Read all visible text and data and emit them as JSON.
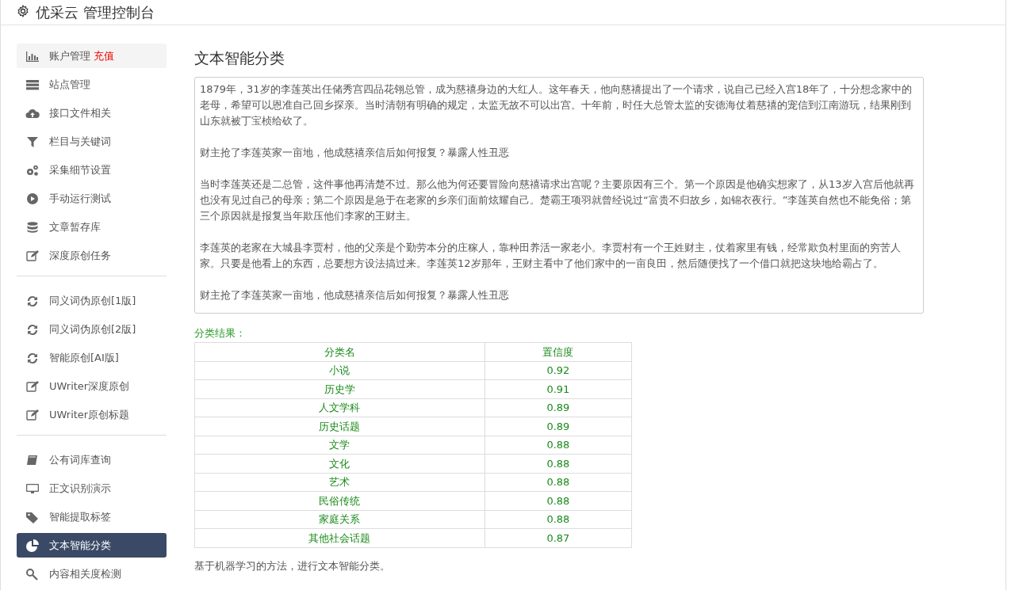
{
  "header": {
    "title": "优采云 管理控制台"
  },
  "sidebar": {
    "groups": [
      [
        {
          "label": "账户管理",
          "badge": "充值",
          "selected": false
        },
        {
          "label": "站点管理",
          "selected": false
        },
        {
          "label": "接口文件相关",
          "selected": false
        },
        {
          "label": "栏目与关键词",
          "selected": false
        },
        {
          "label": "采集细节设置",
          "selected": false
        },
        {
          "label": "手动运行测试",
          "selected": false
        },
        {
          "label": "文章暂存库",
          "selected": false
        },
        {
          "label": "深度原创任务",
          "selected": false
        }
      ],
      [
        {
          "label": "同义词伪原创[1版]",
          "selected": false
        },
        {
          "label": "同义词伪原创[2版]",
          "selected": false
        },
        {
          "label": "智能原创[AI版]",
          "selected": false
        },
        {
          "label": "UWriter深度原创",
          "selected": false
        },
        {
          "label": "UWriter原创标题",
          "selected": false
        }
      ],
      [
        {
          "label": "公有词库查询",
          "selected": false
        },
        {
          "label": "正文识别演示",
          "selected": false
        },
        {
          "label": "智能提取标签",
          "selected": false
        },
        {
          "label": "文本智能分类",
          "selected": true
        },
        {
          "label": "内容相关度检测",
          "selected": false
        }
      ]
    ]
  },
  "main": {
    "title": "文本智能分类",
    "text_input": {
      "paragraphs": [
        "1879年，31岁的李莲英出任储秀宫四品花翎总管，成为慈禧身边的大红人。这年春天，他向慈禧提出了一个请求，说自己已经入宫18年了，十分想念家中的老母，希望可以恩准自己回乡探亲。当时清朝有明确的规定，太监无故不可以出宫。十年前，时任大总管太监的安德海仗着慈禧的宠信到江南游玩，结果刚到山东就被丁宝桢给砍了。",
        "财主抢了李莲英家一亩地，他成慈禧亲信后如何报复？暴露人性丑恶",
        "当时李莲英还是二总管，这件事他再清楚不过。那么他为何还要冒险向慈禧请求出宫呢？主要原因有三个。第一个原因是他确实想家了，从13岁入宫后他就再也没有见过自己的母亲；第二个原因是急于在老家的乡亲们面前炫耀自己。楚霸王项羽就曾经说过“富贵不归故乡，如锦衣夜行。”李莲英自然也不能免俗；第三个原因就是报复当年欺压他们李家的王财主。",
        "李莲英的老家在大城县李贾村，他的父亲是个勤劳本分的庄稼人，靠种田养活一家老小。李贾村有一个王姓财主，仗着家里有钱，经常欺负村里面的穷苦人家。只要是他看上的东西，总要想方设法搞过来。李莲英12岁那年，王财主看中了他们家中的一亩良田，然后随便找了一个借口就把这块地给霸占了。",
        "财主抢了李莲英家一亩地，他成慈禧亲信后如何报复？暴露人性丑恶"
      ]
    },
    "result_label": "分类结果：",
    "table": {
      "columns": [
        "分类名",
        "置信度"
      ],
      "rows": [
        [
          "小说",
          "0.92"
        ],
        [
          "历史学",
          "0.91"
        ],
        [
          "人文学科",
          "0.89"
        ],
        [
          "历史话题",
          "0.89"
        ],
        [
          "文学",
          "0.88"
        ],
        [
          "文化",
          "0.88"
        ],
        [
          "艺术",
          "0.88"
        ],
        [
          "民俗传统",
          "0.88"
        ],
        [
          "家庭关系",
          "0.88"
        ],
        [
          "其他社会话题",
          "0.87"
        ]
      ]
    },
    "footnote": "基于机器学习的方法，进行文本智能分类。"
  }
}
